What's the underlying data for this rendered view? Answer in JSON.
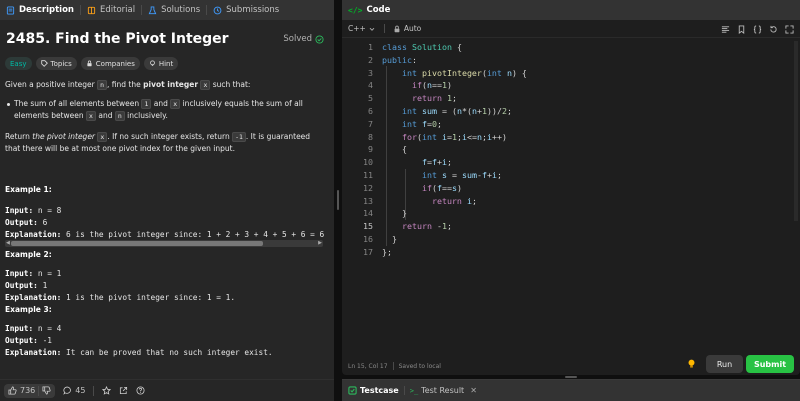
{
  "left_tabs": [
    {
      "label": "Description",
      "icon": "document-icon"
    },
    {
      "label": "Editorial",
      "icon": "book-icon"
    },
    {
      "label": "Solutions",
      "icon": "flask-icon"
    },
    {
      "label": "Submissions",
      "icon": "history-icon"
    }
  ],
  "problem": {
    "title": "2485. Find the Pivot Integer",
    "status": "Solved",
    "difficulty": "Easy",
    "chips": [
      "Topics",
      "Companies",
      "Hint"
    ]
  },
  "description": {
    "p1_a": "Given a positive integer ",
    "p1_n": "n",
    "p1_b": ", find the ",
    "p1_bold": "pivot integer",
    "p1_x": "x",
    "p1_c": " such that:",
    "bullet_a": "The sum of all elements between ",
    "bullet_1": "1",
    "bullet_b": " and ",
    "bullet_x": "x",
    "bullet_c": " inclusively equals the sum of all elements between ",
    "bullet_x2": "x",
    "bullet_d": " and ",
    "bullet_n": "n",
    "bullet_e": " inclusively.",
    "p2_a": "Return ",
    "p2_ital": "the pivot integer",
    "p2_x": "x",
    "p2_b": ". If no such integer exists, return ",
    "p2_neg": "-1",
    "p2_c": ". It is guaranteed that there will be at most one pivot index for the given input."
  },
  "examples": [
    {
      "heading": "Example 1:",
      "input": "n = 8",
      "output": "6",
      "explanation": "6 is the pivot integer since: 1 + 2 + 3 + 4 + 5 + 6 = 6"
    },
    {
      "heading": "Example 2:",
      "input": "n = 1",
      "output": "1",
      "explanation": "1 is the pivot integer since: 1 = 1."
    },
    {
      "heading": "Example 3:",
      "input": "n = 4",
      "output": "-1",
      "explanation": "It can be proved that no such integer exist."
    }
  ],
  "labels": {
    "input": "Input:",
    "output": "Output:",
    "explanation": "Explanation:"
  },
  "footer": {
    "likes": "736",
    "comments": "45"
  },
  "code_panel": {
    "title": "Code",
    "language": "C++",
    "mode": "Auto",
    "status_pos": "Ln 15, Col 17",
    "status_saved": "Saved to local",
    "run": "Run",
    "submit": "Submit"
  },
  "code_lines": [
    "1",
    "2",
    "3",
    "4",
    "5",
    "6",
    "7",
    "8",
    "9",
    "10",
    "11",
    "12",
    "13",
    "14",
    "15",
    "16",
    "17"
  ],
  "bottom_tabs": {
    "testcase": "Testcase",
    "result": "Test Result"
  }
}
